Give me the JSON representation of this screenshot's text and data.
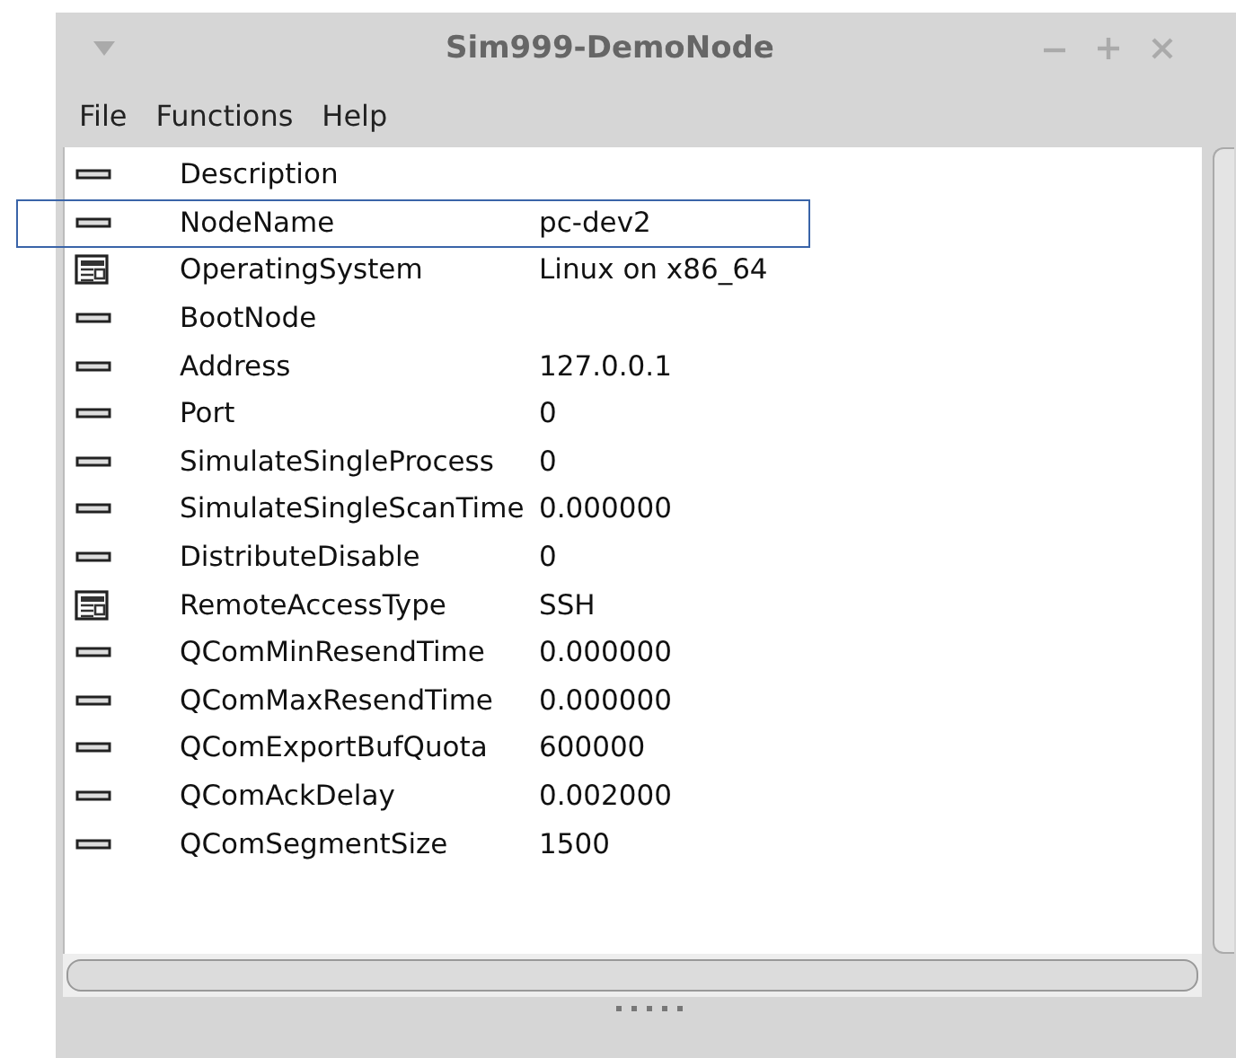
{
  "window": {
    "title": "Sim999-DemoNode"
  },
  "menu": [
    "File",
    "Functions",
    "Help"
  ],
  "rows": [
    {
      "kind": "attribute",
      "name": "Description",
      "value": null,
      "selected": false
    },
    {
      "kind": "attribute",
      "name": "NodeName",
      "value": "pc-dev2",
      "selected": true
    },
    {
      "kind": "enum",
      "name": "OperatingSystem",
      "value": "Linux on x86_64",
      "selected": false
    },
    {
      "kind": "attribute",
      "name": "BootNode",
      "value": null,
      "selected": false
    },
    {
      "kind": "attribute",
      "name": "Address",
      "value": "127.0.0.1",
      "selected": false
    },
    {
      "kind": "attribute",
      "name": "Port",
      "value": "0",
      "selected": false
    },
    {
      "kind": "attribute",
      "name": "SimulateSingleProcess",
      "value": "0",
      "selected": false
    },
    {
      "kind": "attribute",
      "name": "SimulateSingleScanTime",
      "value": "0.000000",
      "selected": false
    },
    {
      "kind": "attribute",
      "name": "DistributeDisable",
      "value": "0",
      "selected": false
    },
    {
      "kind": "enum",
      "name": "RemoteAccessType",
      "value": "SSH",
      "selected": false
    },
    {
      "kind": "attribute",
      "name": "QComMinResendTime",
      "value": "0.000000",
      "selected": false
    },
    {
      "kind": "attribute",
      "name": "QComMaxResendTime",
      "value": "0.000000",
      "selected": false
    },
    {
      "kind": "attribute",
      "name": "QComExportBufQuota",
      "value": "600000",
      "selected": false
    },
    {
      "kind": "attribute",
      "name": "QComAckDelay",
      "value": "0.002000",
      "selected": false
    },
    {
      "kind": "attribute",
      "name": "QComSegmentSize",
      "value": "1500",
      "selected": false
    }
  ]
}
